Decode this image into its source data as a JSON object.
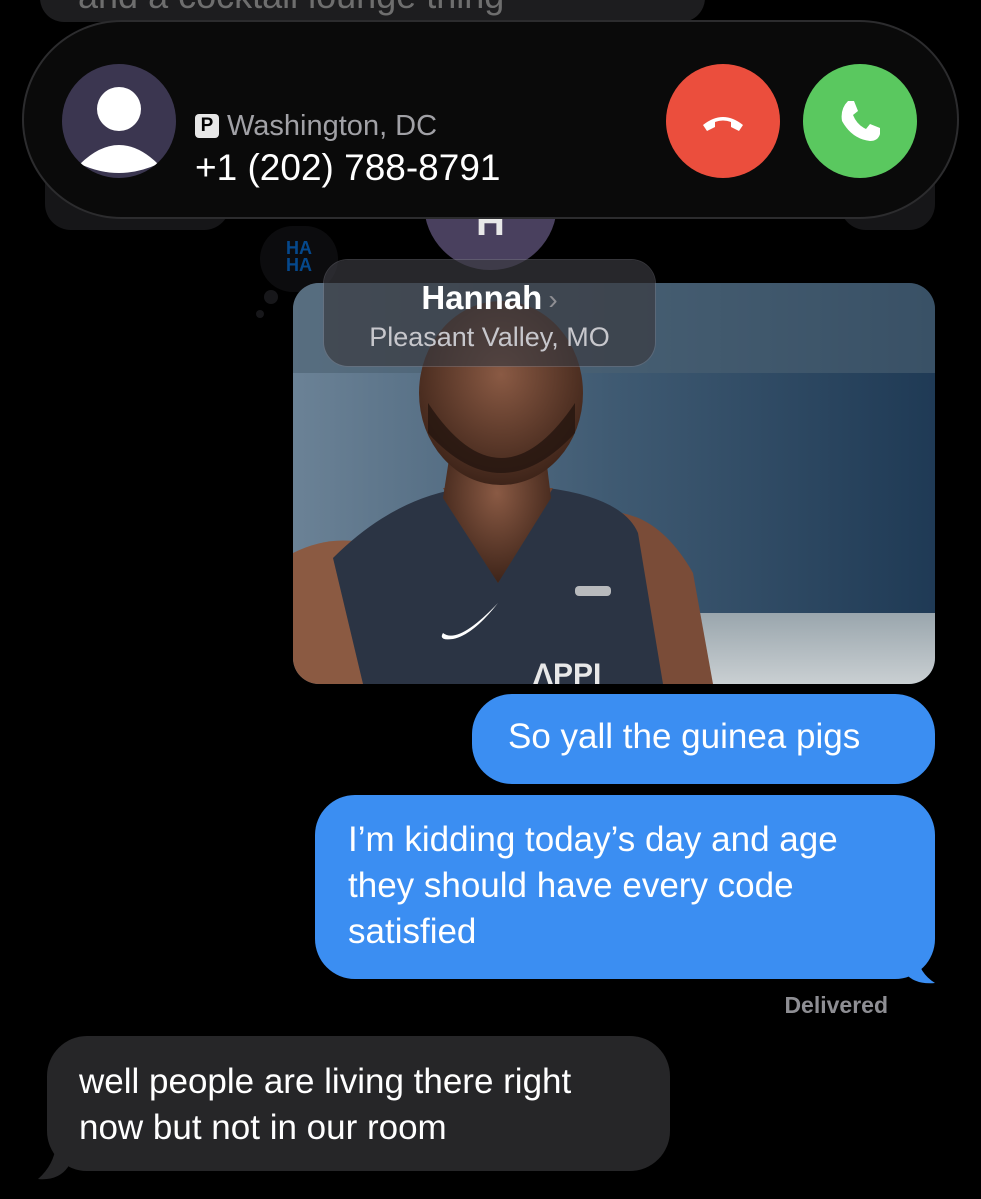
{
  "previous_message": {
    "text": "and a cocktail lounge thing"
  },
  "incoming_call": {
    "caller_location": "Washington, DC",
    "location_badge": "P",
    "caller_number": "+1 (202) 788-8791",
    "avatar_icon": "person-silhouette-icon",
    "decline_icon": "phone-hangup-icon",
    "accept_icon": "phone-icon",
    "decline_color": "#eb4e3d",
    "accept_color": "#5ac85f"
  },
  "tapback": {
    "text": "HA HA"
  },
  "contact": {
    "initial": "H",
    "name": "Hannah",
    "chevron": "›",
    "location": "Pleasant Valley, MO"
  },
  "messages": [
    {
      "direction": "outgoing",
      "text": "So yall the guinea pigs"
    },
    {
      "direction": "outgoing",
      "text": "I’m kidding today’s day and age they should have every code satisfied"
    },
    {
      "direction": "incoming",
      "text": "well people are living there right now but not in our room"
    }
  ],
  "status": {
    "delivered": "Delivered"
  },
  "colors": {
    "outgoing_bubble": "#3b8ef2",
    "incoming_bubble": "#262628"
  }
}
